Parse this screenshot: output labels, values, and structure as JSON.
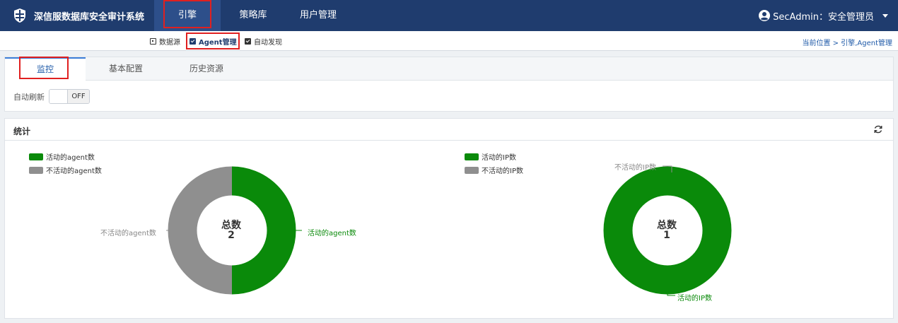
{
  "app": {
    "title": "深信服数据库安全审计系统"
  },
  "nav": {
    "items": [
      "引擎",
      "策略库",
      "用户管理"
    ]
  },
  "user": {
    "label": "SecAdmin：安全管理员"
  },
  "subnav": {
    "items": [
      "数据源",
      "Agent管理",
      "自动发现"
    ]
  },
  "breadcrumb": "当前位置 > 引擎,Agent管理",
  "tabs": [
    "监控",
    "基本配置",
    "历史资源"
  ],
  "autorefresh": {
    "label": "自动刷新",
    "state": "OFF"
  },
  "stats": {
    "title": "统计"
  },
  "colors": {
    "active": "#0a8a0a",
    "inactive": "#8f8f8f",
    "nav": "#1f3c6e"
  },
  "chart_data": [
    {
      "type": "pie",
      "legend": [
        "活动的agent数",
        "不活动的agent数"
      ],
      "labels": [
        "活动的agent数",
        "不活动的agent数"
      ],
      "values": [
        1,
        1
      ],
      "center_title": "总数",
      "center_value": "2"
    },
    {
      "type": "pie",
      "legend": [
        "活动的IP数",
        "不活动的IP数"
      ],
      "labels": [
        "活动的IP数",
        "不活动的IP数"
      ],
      "values": [
        1,
        0
      ],
      "center_title": "总数",
      "center_value": "1"
    }
  ]
}
